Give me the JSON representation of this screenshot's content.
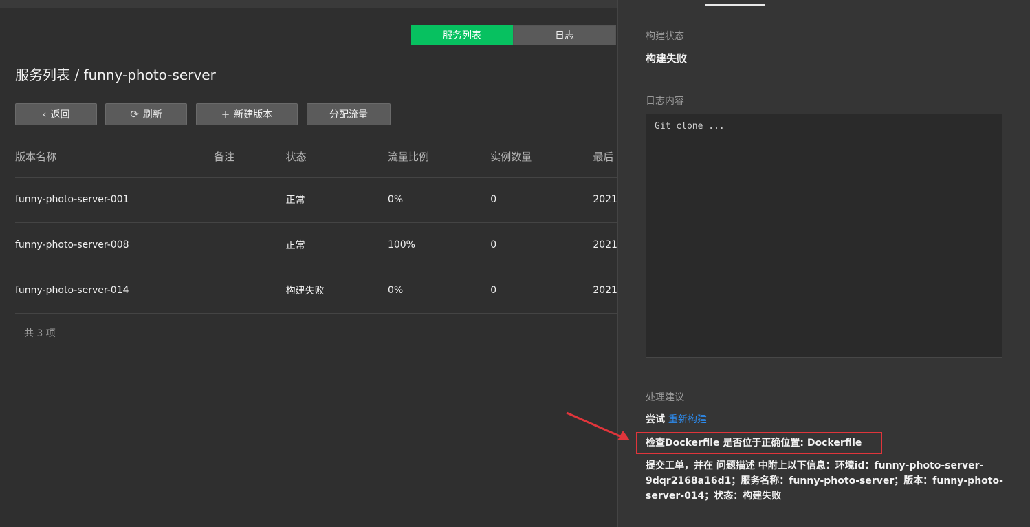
{
  "tabs": [
    {
      "label": "服务列表",
      "active": true
    },
    {
      "label": "日志",
      "active": false
    }
  ],
  "page_title": "服务列表 / funny-photo-server",
  "toolbar": {
    "back": "返回",
    "refresh": "刷新",
    "new_version": "新建版本",
    "assign_traffic": "分配流量"
  },
  "table": {
    "headers": [
      "版本名称",
      "备注",
      "状态",
      "流量比例",
      "实例数量",
      "最后"
    ],
    "rows": [
      {
        "name": "funny-photo-server-001",
        "note": "",
        "status": "正常",
        "traffic": "0%",
        "instances": "0",
        "last": "2021"
      },
      {
        "name": "funny-photo-server-008",
        "note": "",
        "status": "正常",
        "traffic": "100%",
        "instances": "0",
        "last": "2021"
      },
      {
        "name": "funny-photo-server-014",
        "note": "",
        "status": "构建失败",
        "traffic": "0%",
        "instances": "0",
        "last": "2021"
      }
    ],
    "total": "共 3 项"
  },
  "panel": {
    "build_status_label": "构建状态",
    "build_status_value": "构建失败",
    "log_label": "日志内容",
    "log_content": "Git clone ...",
    "advice_label": "处理建议",
    "retry_prefix": "尝试",
    "retry_link": "重新构建",
    "dockerfile_check": "检查Dockerfile 是否位于正确位置: Dockerfile",
    "ticket_text": "提交工单，并在 问题描述 中附上以下信息：环境id：funny-photo-server-9dqr2168a16d1；服务名称：funny-photo-server；版本：funny-photo-server-014；状态：构建失败"
  },
  "colors": {
    "accent": "#07c160",
    "link": "#2d8cf0",
    "highlight_border": "#e0353b"
  }
}
